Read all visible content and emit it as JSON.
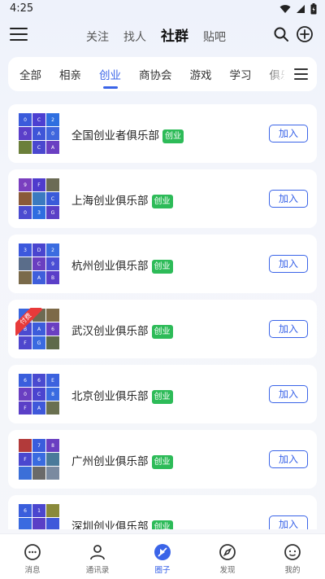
{
  "status_bar": {
    "time": "4:25"
  },
  "top_nav": {
    "tabs": [
      {
        "label": "关注",
        "active": false
      },
      {
        "label": "找人",
        "active": false
      },
      {
        "label": "社群",
        "active": true
      },
      {
        "label": "贴吧",
        "active": false
      }
    ]
  },
  "categories": {
    "items": [
      "全部",
      "相亲",
      "创业",
      "商协会",
      "游戏",
      "学习",
      "俱乐部"
    ],
    "active_index": 2
  },
  "groups": [
    {
      "name": "全国创业者俱乐部",
      "tag": "创业",
      "join_label": "加入",
      "paid": false,
      "tiles": [
        {
          "label": "0",
          "color": "#3b5bdb"
        },
        {
          "label": "C",
          "color": "#4c3fd1"
        },
        {
          "label": "2",
          "color": "#2f6fe0"
        },
        {
          "label": "0",
          "color": "#5b3fc9"
        },
        {
          "label": "A",
          "color": "#3f55d8"
        },
        {
          "label": "0",
          "color": "#4066dd"
        },
        {
          "label": "",
          "color": "#6b7f3a"
        },
        {
          "label": "C",
          "color": "#4a47cf"
        },
        {
          "label": "A",
          "color": "#6a3fc2"
        }
      ]
    },
    {
      "name": "上海创业俱乐部",
      "tag": "创业",
      "join_label": "加入",
      "paid": false,
      "tiles": [
        {
          "label": "9",
          "color": "#7a3fbf"
        },
        {
          "label": "F",
          "color": "#4f3bcd"
        },
        {
          "label": "",
          "color": "#6b6b55"
        },
        {
          "label": "",
          "color": "#8a5a3a"
        },
        {
          "label": "",
          "color": "#3b7ac0"
        },
        {
          "label": "C",
          "color": "#3a5bd9"
        },
        {
          "label": "0",
          "color": "#4b4bd0"
        },
        {
          "label": "3",
          "color": "#2f6de0"
        },
        {
          "label": "G",
          "color": "#5a3fc6"
        }
      ]
    },
    {
      "name": "杭州创业俱乐部",
      "tag": "创业",
      "join_label": "加入",
      "paid": false,
      "tiles": [
        {
          "label": "3",
          "color": "#3c58dc"
        },
        {
          "label": "D",
          "color": "#4a45cf"
        },
        {
          "label": "2",
          "color": "#3a6ce0"
        },
        {
          "label": "",
          "color": "#5a6d8a"
        },
        {
          "label": "C",
          "color": "#6a3fc0"
        },
        {
          "label": "9",
          "color": "#4b4fd4"
        },
        {
          "label": "",
          "color": "#7a6a4a"
        },
        {
          "label": "A",
          "color": "#3f5edb"
        },
        {
          "label": "B",
          "color": "#5b3fc8"
        }
      ]
    },
    {
      "name": "武汉创业俱乐部",
      "tag": "创业",
      "join_label": "加入",
      "paid": true,
      "paid_label": "付费",
      "tiles": [
        {
          "label": "",
          "color": "#3a66de"
        },
        {
          "label": "",
          "color": "#6d6a52"
        },
        {
          "label": "",
          "color": "#7d6a48"
        },
        {
          "label": "B",
          "color": "#4b4ad0"
        },
        {
          "label": "A",
          "color": "#3c5cdb"
        },
        {
          "label": "6",
          "color": "#6a3fc1"
        },
        {
          "label": "F",
          "color": "#4f46cd"
        },
        {
          "label": "G",
          "color": "#3a6ae0"
        },
        {
          "label": "",
          "color": "#5e6a4a"
        }
      ]
    },
    {
      "name": "北京创业俱乐部",
      "tag": "创业",
      "join_label": "加入",
      "paid": false,
      "tiles": [
        {
          "label": "6",
          "color": "#3a5edc"
        },
        {
          "label": "6",
          "color": "#4a4ad0"
        },
        {
          "label": "E",
          "color": "#3c62de"
        },
        {
          "label": "0",
          "color": "#6a3fc1"
        },
        {
          "label": "C",
          "color": "#4b44cf"
        },
        {
          "label": "8",
          "color": "#3a6be0"
        },
        {
          "label": "F",
          "color": "#5a3fc7"
        },
        {
          "label": "A",
          "color": "#3f58da"
        },
        {
          "label": "",
          "color": "#6a7050"
        }
      ]
    },
    {
      "name": "广州创业俱乐部",
      "tag": "创业",
      "join_label": "加入",
      "paid": false,
      "tiles": [
        {
          "label": "",
          "color": "#b23a3a"
        },
        {
          "label": "7",
          "color": "#3a5ddc"
        },
        {
          "label": "8",
          "color": "#6a3fc1"
        },
        {
          "label": "F",
          "color": "#4a47cf"
        },
        {
          "label": "6",
          "color": "#3a6be0"
        },
        {
          "label": "",
          "color": "#4a7a9a"
        },
        {
          "label": "",
          "color": "#3b6fd8"
        },
        {
          "label": "",
          "color": "#6a6a6a"
        },
        {
          "label": "",
          "color": "#7a8aa0"
        }
      ]
    },
    {
      "name": "深圳创业俱乐部",
      "tag": "创业",
      "join_label": "加入",
      "paid": false,
      "tiles": [
        {
          "label": "6",
          "color": "#3a5edc"
        },
        {
          "label": "1",
          "color": "#4b46cf"
        },
        {
          "label": "",
          "color": "#8a8a3a"
        },
        {
          "label": "",
          "color": "#3a6ae0"
        },
        {
          "label": "",
          "color": "#5a3fc6"
        },
        {
          "label": "",
          "color": "#3f58da"
        },
        {
          "label": "",
          "color": "#4a4ad0"
        },
        {
          "label": "",
          "color": "#6a3fc1"
        },
        {
          "label": "",
          "color": "#3a66de"
        }
      ]
    }
  ],
  "bottom_nav": {
    "items": [
      {
        "label": "消息",
        "icon": "message-icon",
        "active": false
      },
      {
        "label": "通讯录",
        "icon": "contacts-icon",
        "active": false
      },
      {
        "label": "圈子",
        "icon": "circle-icon",
        "active": true
      },
      {
        "label": "发现",
        "icon": "compass-icon",
        "active": false
      },
      {
        "label": "我的",
        "icon": "profile-icon",
        "active": false
      }
    ]
  },
  "colors": {
    "accent": "#3a64e8",
    "tag_green": "#2dbb58",
    "paid_red": "#e83a3a"
  }
}
